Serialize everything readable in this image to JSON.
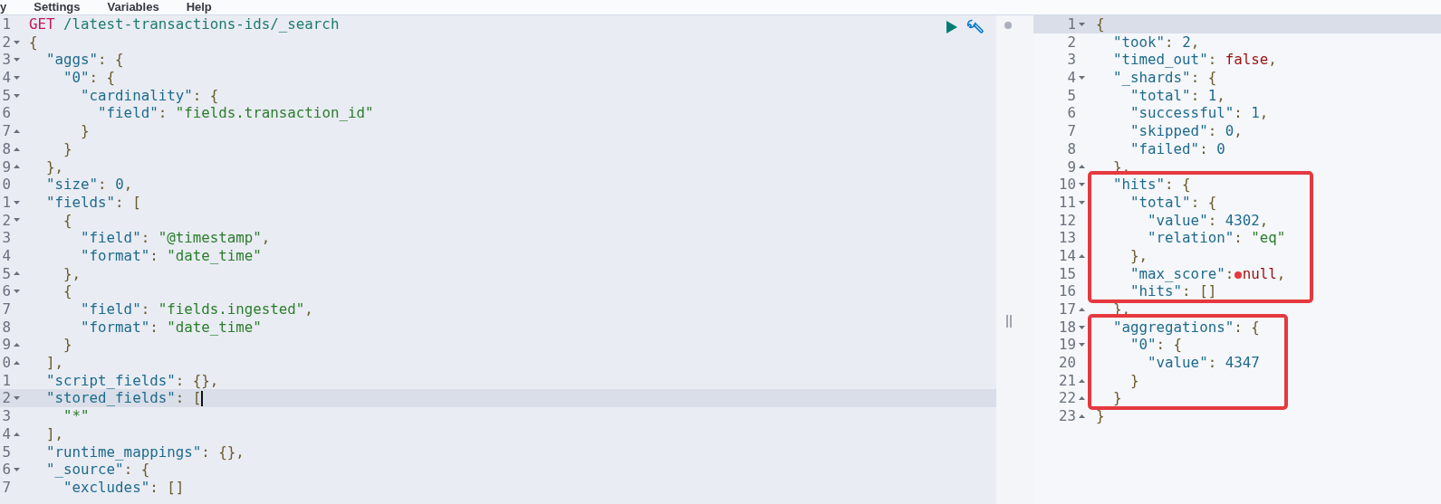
{
  "menu": [
    {
      "label": "y"
    },
    {
      "label": "Settings"
    },
    {
      "label": "Variables"
    },
    {
      "label": "Help"
    }
  ],
  "request_editor": {
    "lines": [
      {
        "number": "1",
        "kind": "plain",
        "active": false,
        "tokens": [
          {
            "kind": "method",
            "text": "GET"
          },
          {
            "kind": "path",
            "text": " /latest-transactions-ids/_search"
          }
        ]
      },
      {
        "number": "2",
        "kind": "fold_start",
        "active": false,
        "tokens": [
          {
            "kind": "punct",
            "text": "{"
          }
        ]
      },
      {
        "number": "3",
        "kind": "fold_start",
        "active": false,
        "tokens": [
          {
            "kind": "key",
            "text": "  \"aggs\""
          },
          {
            "kind": "punct",
            "text": ": {"
          }
        ]
      },
      {
        "number": "4",
        "kind": "fold_start",
        "active": false,
        "tokens": [
          {
            "kind": "key",
            "text": "    \"0\""
          },
          {
            "kind": "punct",
            "text": ": {"
          }
        ]
      },
      {
        "number": "5",
        "kind": "fold_start",
        "active": false,
        "tokens": [
          {
            "kind": "key",
            "text": "      \"cardinality\""
          },
          {
            "kind": "punct",
            "text": ": {"
          }
        ]
      },
      {
        "number": "6",
        "kind": "plain",
        "active": false,
        "tokens": [
          {
            "kind": "key",
            "text": "        \"field\""
          },
          {
            "kind": "punct",
            "text": ": "
          },
          {
            "kind": "string",
            "text": "\"fields.transaction_id\""
          }
        ]
      },
      {
        "number": "7",
        "kind": "fold_end",
        "active": false,
        "tokens": [
          {
            "kind": "punct",
            "text": "      }"
          }
        ]
      },
      {
        "number": "8",
        "kind": "fold_end",
        "active": false,
        "tokens": [
          {
            "kind": "punct",
            "text": "    }"
          }
        ]
      },
      {
        "number": "9",
        "kind": "fold_end",
        "active": false,
        "tokens": [
          {
            "kind": "punct",
            "text": "  },"
          }
        ]
      },
      {
        "number": "0",
        "kind": "plain",
        "active": false,
        "tokens": [
          {
            "kind": "key",
            "text": "  \"size\""
          },
          {
            "kind": "punct",
            "text": ": "
          },
          {
            "kind": "number",
            "text": "0"
          },
          {
            "kind": "punct",
            "text": ","
          }
        ]
      },
      {
        "number": "1",
        "kind": "fold_start",
        "active": false,
        "tokens": [
          {
            "kind": "key",
            "text": "  \"fields\""
          },
          {
            "kind": "punct",
            "text": ": ["
          }
        ]
      },
      {
        "number": "2",
        "kind": "fold_start",
        "active": false,
        "tokens": [
          {
            "kind": "punct",
            "text": "    {"
          }
        ]
      },
      {
        "number": "3",
        "kind": "plain",
        "active": false,
        "tokens": [
          {
            "kind": "key",
            "text": "      \"field\""
          },
          {
            "kind": "punct",
            "text": ": "
          },
          {
            "kind": "string",
            "text": "\"@timestamp\""
          },
          {
            "kind": "punct",
            "text": ","
          }
        ]
      },
      {
        "number": "4",
        "kind": "plain",
        "active": false,
        "tokens": [
          {
            "kind": "key",
            "text": "      \"format\""
          },
          {
            "kind": "punct",
            "text": ": "
          },
          {
            "kind": "string",
            "text": "\"date_time\""
          }
        ]
      },
      {
        "number": "5",
        "kind": "fold_end",
        "active": false,
        "tokens": [
          {
            "kind": "punct",
            "text": "    },"
          }
        ]
      },
      {
        "number": "6",
        "kind": "fold_start",
        "active": false,
        "tokens": [
          {
            "kind": "punct",
            "text": "    {"
          }
        ]
      },
      {
        "number": "7",
        "kind": "plain",
        "active": false,
        "tokens": [
          {
            "kind": "key",
            "text": "      \"field\""
          },
          {
            "kind": "punct",
            "text": ": "
          },
          {
            "kind": "string",
            "text": "\"fields.ingested\""
          },
          {
            "kind": "punct",
            "text": ","
          }
        ]
      },
      {
        "number": "8",
        "kind": "plain",
        "active": false,
        "tokens": [
          {
            "kind": "key",
            "text": "      \"format\""
          },
          {
            "kind": "punct",
            "text": ": "
          },
          {
            "kind": "string",
            "text": "\"date_time\""
          }
        ]
      },
      {
        "number": "9",
        "kind": "fold_end",
        "active": false,
        "tokens": [
          {
            "kind": "punct",
            "text": "    }"
          }
        ]
      },
      {
        "number": "0",
        "kind": "fold_end",
        "active": false,
        "tokens": [
          {
            "kind": "punct",
            "text": "  ],"
          }
        ]
      },
      {
        "number": "1",
        "kind": "plain",
        "active": false,
        "tokens": [
          {
            "kind": "key",
            "text": "  \"script_fields\""
          },
          {
            "kind": "punct",
            "text": ": {},"
          }
        ]
      },
      {
        "number": "2",
        "kind": "fold_start",
        "active": true,
        "tokens": [
          {
            "kind": "key",
            "text": "  \"stored_fields\""
          },
          {
            "kind": "punct",
            "text": ": ["
          }
        ]
      },
      {
        "number": "3",
        "kind": "plain",
        "active": false,
        "tokens": [
          {
            "kind": "string",
            "text": "    \"*\""
          }
        ]
      },
      {
        "number": "4",
        "kind": "fold_end",
        "active": false,
        "tokens": [
          {
            "kind": "punct",
            "text": "  ],"
          }
        ]
      },
      {
        "number": "5",
        "kind": "plain",
        "active": false,
        "tokens": [
          {
            "kind": "key",
            "text": "  \"runtime_mappings\""
          },
          {
            "kind": "punct",
            "text": ": {},"
          }
        ]
      },
      {
        "number": "6",
        "kind": "fold_start",
        "active": false,
        "tokens": [
          {
            "kind": "key",
            "text": "  \"_source\""
          },
          {
            "kind": "punct",
            "text": ": {"
          }
        ]
      },
      {
        "number": "7",
        "kind": "plain",
        "active": false,
        "tokens": [
          {
            "kind": "key",
            "text": "    \"excludes\""
          },
          {
            "kind": "punct",
            "text": ": []"
          }
        ]
      }
    ]
  },
  "response_editor": {
    "blocks": [
      {
        "kind": "plain",
        "lines": [
          {
            "number": "1",
            "kind": "fold_start",
            "active": true,
            "pen_dot": false,
            "tokens": [
              {
                "kind": "punct",
                "text": "{"
              }
            ]
          },
          {
            "number": "2",
            "kind": "plain",
            "active": false,
            "pen_dot": false,
            "tokens": [
              {
                "kind": "key",
                "text": "  \"took\""
              },
              {
                "kind": "punct",
                "text": ": "
              },
              {
                "kind": "number",
                "text": "2"
              },
              {
                "kind": "punct",
                "text": ","
              }
            ]
          },
          {
            "number": "3",
            "kind": "plain",
            "active": false,
            "pen_dot": false,
            "tokens": [
              {
                "kind": "key",
                "text": "  \"timed_out\""
              },
              {
                "kind": "punct",
                "text": ": "
              },
              {
                "kind": "literal",
                "text": "false"
              },
              {
                "kind": "punct",
                "text": ","
              }
            ]
          },
          {
            "number": "4",
            "kind": "fold_start",
            "active": false,
            "pen_dot": false,
            "tokens": [
              {
                "kind": "key",
                "text": "  \"_shards\""
              },
              {
                "kind": "punct",
                "text": ": {"
              }
            ]
          },
          {
            "number": "5",
            "kind": "plain",
            "active": false,
            "pen_dot": false,
            "tokens": [
              {
                "kind": "key",
                "text": "    \"total\""
              },
              {
                "kind": "punct",
                "text": ": "
              },
              {
                "kind": "number",
                "text": "1"
              },
              {
                "kind": "punct",
                "text": ","
              }
            ]
          },
          {
            "number": "6",
            "kind": "plain",
            "active": false,
            "pen_dot": false,
            "tokens": [
              {
                "kind": "key",
                "text": "    \"successful\""
              },
              {
                "kind": "punct",
                "text": ": "
              },
              {
                "kind": "number",
                "text": "1"
              },
              {
                "kind": "punct",
                "text": ","
              }
            ]
          },
          {
            "number": "7",
            "kind": "plain",
            "active": false,
            "pen_dot": false,
            "tokens": [
              {
                "kind": "key",
                "text": "    \"skipped\""
              },
              {
                "kind": "punct",
                "text": ": "
              },
              {
                "kind": "number",
                "text": "0"
              },
              {
                "kind": "punct",
                "text": ","
              }
            ]
          },
          {
            "number": "8",
            "kind": "plain",
            "active": false,
            "pen_dot": false,
            "tokens": [
              {
                "kind": "key",
                "text": "    \"failed\""
              },
              {
                "kind": "punct",
                "text": ": "
              },
              {
                "kind": "number",
                "text": "0"
              }
            ]
          },
          {
            "number": "9",
            "kind": "fold_end",
            "active": false,
            "pen_dot": false,
            "tokens": [
              {
                "kind": "punct",
                "text": "  },"
              }
            ]
          }
        ]
      },
      {
        "kind": "boxed",
        "lines": [
          {
            "number": "10",
            "kind": "fold_start",
            "active": false,
            "pen_dot": false,
            "tokens": [
              {
                "kind": "key",
                "text": "  \"hits\""
              },
              {
                "kind": "punct",
                "text": ": {"
              }
            ]
          },
          {
            "number": "11",
            "kind": "fold_start",
            "active": false,
            "pen_dot": false,
            "tokens": [
              {
                "kind": "key",
                "text": "    \"total\""
              },
              {
                "kind": "punct",
                "text": ": {"
              }
            ]
          },
          {
            "number": "12",
            "kind": "plain",
            "active": false,
            "pen_dot": false,
            "tokens": [
              {
                "kind": "key",
                "text": "      \"value\""
              },
              {
                "kind": "punct",
                "text": ": "
              },
              {
                "kind": "number",
                "text": "4302"
              },
              {
                "kind": "punct",
                "text": ","
              }
            ]
          },
          {
            "number": "13",
            "kind": "plain",
            "active": false,
            "pen_dot": false,
            "tokens": [
              {
                "kind": "key",
                "text": "      \"relation\""
              },
              {
                "kind": "punct",
                "text": ": "
              },
              {
                "kind": "string",
                "text": "\"eq\""
              }
            ]
          },
          {
            "number": "14",
            "kind": "fold_end",
            "active": false,
            "pen_dot": false,
            "tokens": [
              {
                "kind": "punct",
                "text": "    },"
              }
            ]
          },
          {
            "number": "15",
            "kind": "plain",
            "active": false,
            "pen_dot": true,
            "tokens": [
              {
                "kind": "key",
                "text": "    \"max_score\""
              },
              {
                "kind": "punct",
                "text": ": "
              },
              {
                "kind": "literal",
                "text": "null"
              },
              {
                "kind": "punct",
                "text": ","
              }
            ]
          },
          {
            "number": "16",
            "kind": "plain",
            "active": false,
            "pen_dot": false,
            "tokens": [
              {
                "kind": "key",
                "text": "    \"hits\""
              },
              {
                "kind": "punct",
                "text": ": []"
              }
            ]
          }
        ]
      },
      {
        "kind": "plain",
        "lines": [
          {
            "number": "17",
            "kind": "fold_end",
            "active": false,
            "pen_dot": false,
            "tokens": [
              {
                "kind": "punct",
                "text": "  },"
              }
            ]
          }
        ]
      },
      {
        "kind": "boxed",
        "lines": [
          {
            "number": "18",
            "kind": "fold_start",
            "active": false,
            "pen_dot": false,
            "tokens": [
              {
                "kind": "key",
                "text": "  \"aggregations\""
              },
              {
                "kind": "punct",
                "text": ": {"
              }
            ]
          },
          {
            "number": "19",
            "kind": "fold_start",
            "active": false,
            "pen_dot": false,
            "tokens": [
              {
                "kind": "key",
                "text": "    \"0\""
              },
              {
                "kind": "punct",
                "text": ": {"
              }
            ]
          },
          {
            "number": "20",
            "kind": "plain",
            "active": false,
            "pen_dot": false,
            "tokens": [
              {
                "kind": "key",
                "text": "      \"value\""
              },
              {
                "kind": "punct",
                "text": ": "
              },
              {
                "kind": "number",
                "text": "4347"
              }
            ]
          },
          {
            "number": "21",
            "kind": "fold_end",
            "active": false,
            "pen_dot": false,
            "tokens": [
              {
                "kind": "punct",
                "text": "    }"
              }
            ]
          },
          {
            "number": "22",
            "kind": "fold_end",
            "active": false,
            "pen_dot": false,
            "tokens": [
              {
                "kind": "punct",
                "text": "  }"
              }
            ]
          }
        ]
      },
      {
        "kind": "plain",
        "lines": [
          {
            "number": "23",
            "kind": "fold_end",
            "active": false,
            "pen_dot": false,
            "tokens": [
              {
                "kind": "punct",
                "text": "}"
              }
            ]
          }
        ]
      }
    ]
  }
}
